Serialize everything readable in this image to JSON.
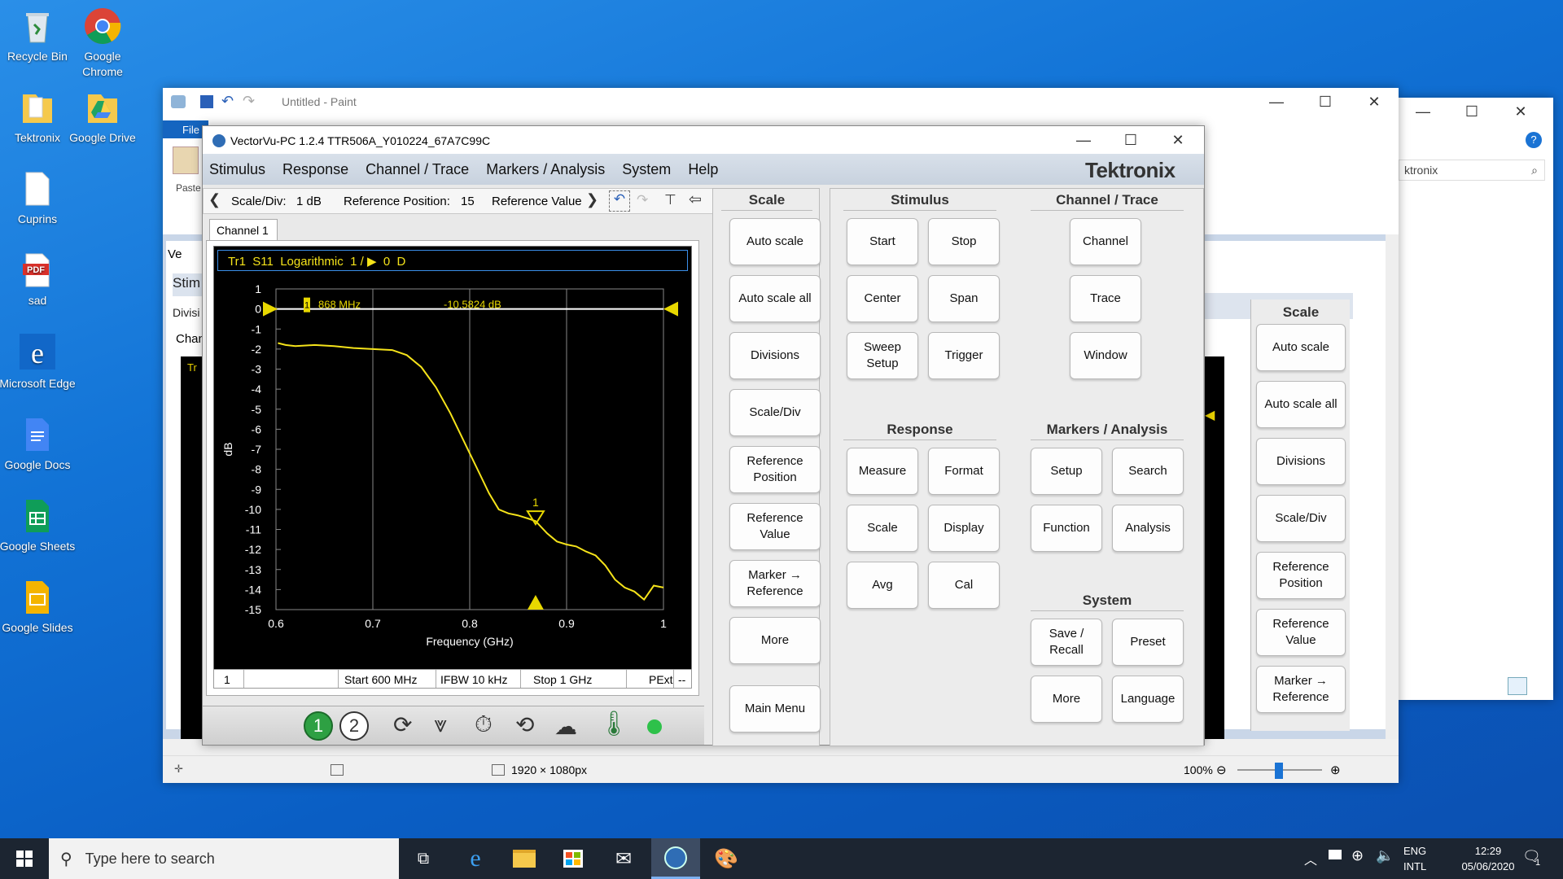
{
  "desktop": {
    "icons": [
      {
        "label": "Recycle Bin"
      },
      {
        "label": "Google Chrome"
      },
      {
        "label": "Tektronix"
      },
      {
        "label": "Google Drive"
      },
      {
        "label": "Cuprins"
      },
      {
        "label": "sad"
      },
      {
        "label": "Microsoft Edge"
      },
      {
        "label": "Google Docs"
      },
      {
        "label": "Google Sheets"
      },
      {
        "label": "Google Slides"
      }
    ]
  },
  "paint": {
    "title": "Untitled - Paint",
    "file_tab": "File",
    "paste": "Paste",
    "status_size": "1920 × 1080px",
    "zoom": "100%",
    "canvas_frag": {
      "ve": "Ve",
      "stim": "Stim",
      "divisi": "Divisi",
      "chan": "Chan",
      "tr": "Tr"
    }
  },
  "explorer": {
    "search_text": "ktronix"
  },
  "vv": {
    "title": "VectorVu-PC 1.2.4 TTR506A_Y010224_67A7C99C",
    "menu": [
      "Stimulus",
      "Response",
      "Channel / Trace",
      "Markers / Analysis",
      "System",
      "Help"
    ],
    "brand": "Tektronix",
    "toolbar": {
      "scale_label": "Scale/Div:",
      "scale_val": "1 dB",
      "ref_pos_label": "Reference Position:",
      "ref_pos_val": "15",
      "ref_val_label": "Reference Value"
    },
    "channel_tab": "Channel 1",
    "trace_header": {
      "tr": "Tr1",
      "param": "S11",
      "format": "Logarithmic",
      "scale": "1 /",
      "ref": "0",
      "flag": "D"
    },
    "marker_readout": {
      "id": "1",
      "freq": "868 MHz",
      "val": "-10.5824 dB"
    },
    "status": {
      "ch": "1",
      "start": "Start 600 MHz",
      "ifbw": "IFBW 10 kHz",
      "stop": "Stop 1 GHz",
      "pext": "PExt",
      "end": "--"
    },
    "bottom_icons": {
      "ch1": "1",
      "ch2": "2"
    },
    "scale_panel": {
      "title": "Scale",
      "buttons": [
        "Auto scale",
        "Auto scale all",
        "Divisions",
        "Scale/Div",
        "Reference Position",
        "Reference Value",
        "Marker → Reference",
        "More"
      ],
      "main_menu": "Main Menu"
    },
    "stimulus": {
      "title": "Stimulus",
      "buttons": [
        "Start",
        "Stop",
        "Center",
        "Span",
        "Sweep Setup",
        "Trigger"
      ]
    },
    "channel_trace": {
      "title": "Channel / Trace",
      "buttons": [
        "Channel",
        "Trace",
        "Window"
      ]
    },
    "response": {
      "title": "Response",
      "buttons": [
        "Measure",
        "Format",
        "Scale",
        "Display",
        "Avg",
        "Cal"
      ]
    },
    "markers": {
      "title": "Markers / Analysis",
      "buttons": [
        "Setup",
        "Search",
        "Function",
        "Analysis"
      ]
    },
    "system": {
      "title": "System",
      "buttons": [
        "Save / Recall",
        "Preset",
        "More",
        "Language"
      ]
    }
  },
  "bg_vv": {
    "scale_title": "Scale",
    "buttons": [
      "Auto scale",
      "Auto scale all",
      "Divisions",
      "Scale/Div",
      "Reference Position",
      "Reference Value",
      "Marker → Reference"
    ]
  },
  "taskbar": {
    "search_placeholder": "Type here to search",
    "lang1": "ENG",
    "lang2": "INTL",
    "time": "12:29",
    "date": "05/06/2020",
    "notif": "1"
  },
  "chart_data": {
    "type": "line",
    "xlabel": "Frequency (GHz)",
    "ylabel": "dB",
    "xlim": [
      0.6,
      1.0
    ],
    "ylim": [
      -15,
      1
    ],
    "xticks": [
      "0.6",
      "0.7",
      "0.8",
      "0.9",
      "1"
    ],
    "yticks": [
      "1",
      "0",
      "-1",
      "-2",
      "-3",
      "-4",
      "-5",
      "-6",
      "-7",
      "-8",
      "-9",
      "-10",
      "-11",
      "-12",
      "-13",
      "-14",
      "-15"
    ],
    "reference_level": 0,
    "marker": {
      "x": 0.868,
      "y": -10.58
    },
    "series": [
      {
        "color": "#f5e31a",
        "x": [
          0.602,
          0.61,
          0.62,
          0.64,
          0.66,
          0.68,
          0.7,
          0.72,
          0.735,
          0.75,
          0.765,
          0.78,
          0.79,
          0.8,
          0.81,
          0.82,
          0.83,
          0.84,
          0.85,
          0.86,
          0.868,
          0.88,
          0.89,
          0.9,
          0.91,
          0.92,
          0.93,
          0.94,
          0.95,
          0.96,
          0.97,
          0.98,
          0.99,
          1.0
        ],
        "y": [
          -1.7,
          -1.8,
          -1.85,
          -1.8,
          -1.85,
          -1.95,
          -2.0,
          -2.05,
          -2.3,
          -2.9,
          -3.9,
          -5.2,
          -6.2,
          -7.2,
          -8.2,
          -9.2,
          -10.0,
          -10.2,
          -10.3,
          -10.45,
          -10.58,
          -11.2,
          -11.6,
          -11.75,
          -11.85,
          -12.1,
          -12.3,
          -12.8,
          -13.5,
          -13.9,
          -14.1,
          -14.5,
          -13.8,
          -13.9
        ]
      }
    ]
  }
}
